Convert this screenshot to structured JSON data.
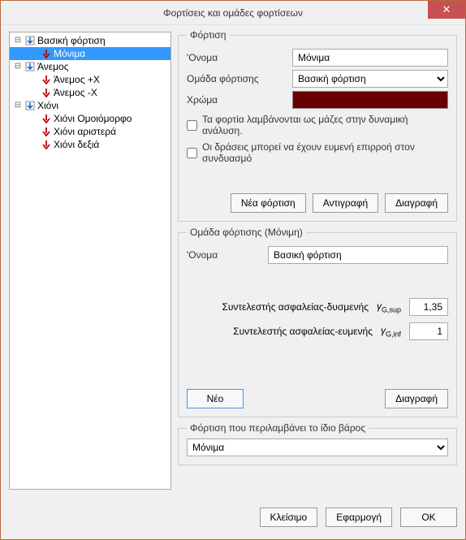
{
  "window": {
    "title": "Φορτίσεις και ομάδες φορτίσεων"
  },
  "tree": {
    "n0": "Βασική φόρτιση",
    "n0_0": "Μόνιμα",
    "n1": "Άνεμος",
    "n1_0": "Άνεμος +Χ",
    "n1_1": "Άνεμος -Χ",
    "n2": "Χιόνι",
    "n2_0": "Χιόνι Ομοιόμορφο",
    "n2_1": "Χιόνι αριστερά",
    "n2_2": "Χιόνι δεξιά"
  },
  "loading": {
    "legend": "Φόρτιση",
    "name_label": "'Ονομα",
    "name_value": "Μόνιμα",
    "group_label": "Ομάδα φόρτισης",
    "group_value": "Βασική φόρτιση",
    "color_label": "Χρώμα",
    "chk_mass": "Τα φορτία λαμβάνονται ως μάζες στην δυναμική ανάλυση.",
    "chk_fav": "Οι δράσεις μπορεί να έχουν ευμενή επιρροή στον συνδυασμό",
    "btn_new": "Νέα φόρτιση",
    "btn_copy": "Αντιγραφή",
    "btn_delete": "Διαγραφή"
  },
  "group": {
    "legend": "Ομάδα φόρτισης (Μόνιμη)",
    "name_label": "'Ονομα",
    "name_value": "Βασική φόρτιση",
    "coeff_unfav_label": "Συντελεστής ασφαλείας-δυσμενής",
    "coeff_unfav_sym": "γ",
    "coeff_unfav_sub": "G,sup",
    "coeff_unfav_val": "1,35",
    "coeff_fav_label": "Συντελεστής ασφαλείας-ευμενής",
    "coeff_fav_sym": "γ",
    "coeff_fav_sub": "G,inf",
    "coeff_fav_val": "1",
    "btn_new": "Νέο",
    "btn_delete": "Διαγραφή"
  },
  "selfweight": {
    "legend": "Φόρτιση που περιλαμβάνει το ίδιο βάρος",
    "value": "Μόνιμα"
  },
  "bottom": {
    "close": "Κλείσιμο",
    "apply": "Εφαρμογή",
    "ok": "OK"
  },
  "glyph": {
    "minus": "⊟",
    "close": "✕"
  }
}
